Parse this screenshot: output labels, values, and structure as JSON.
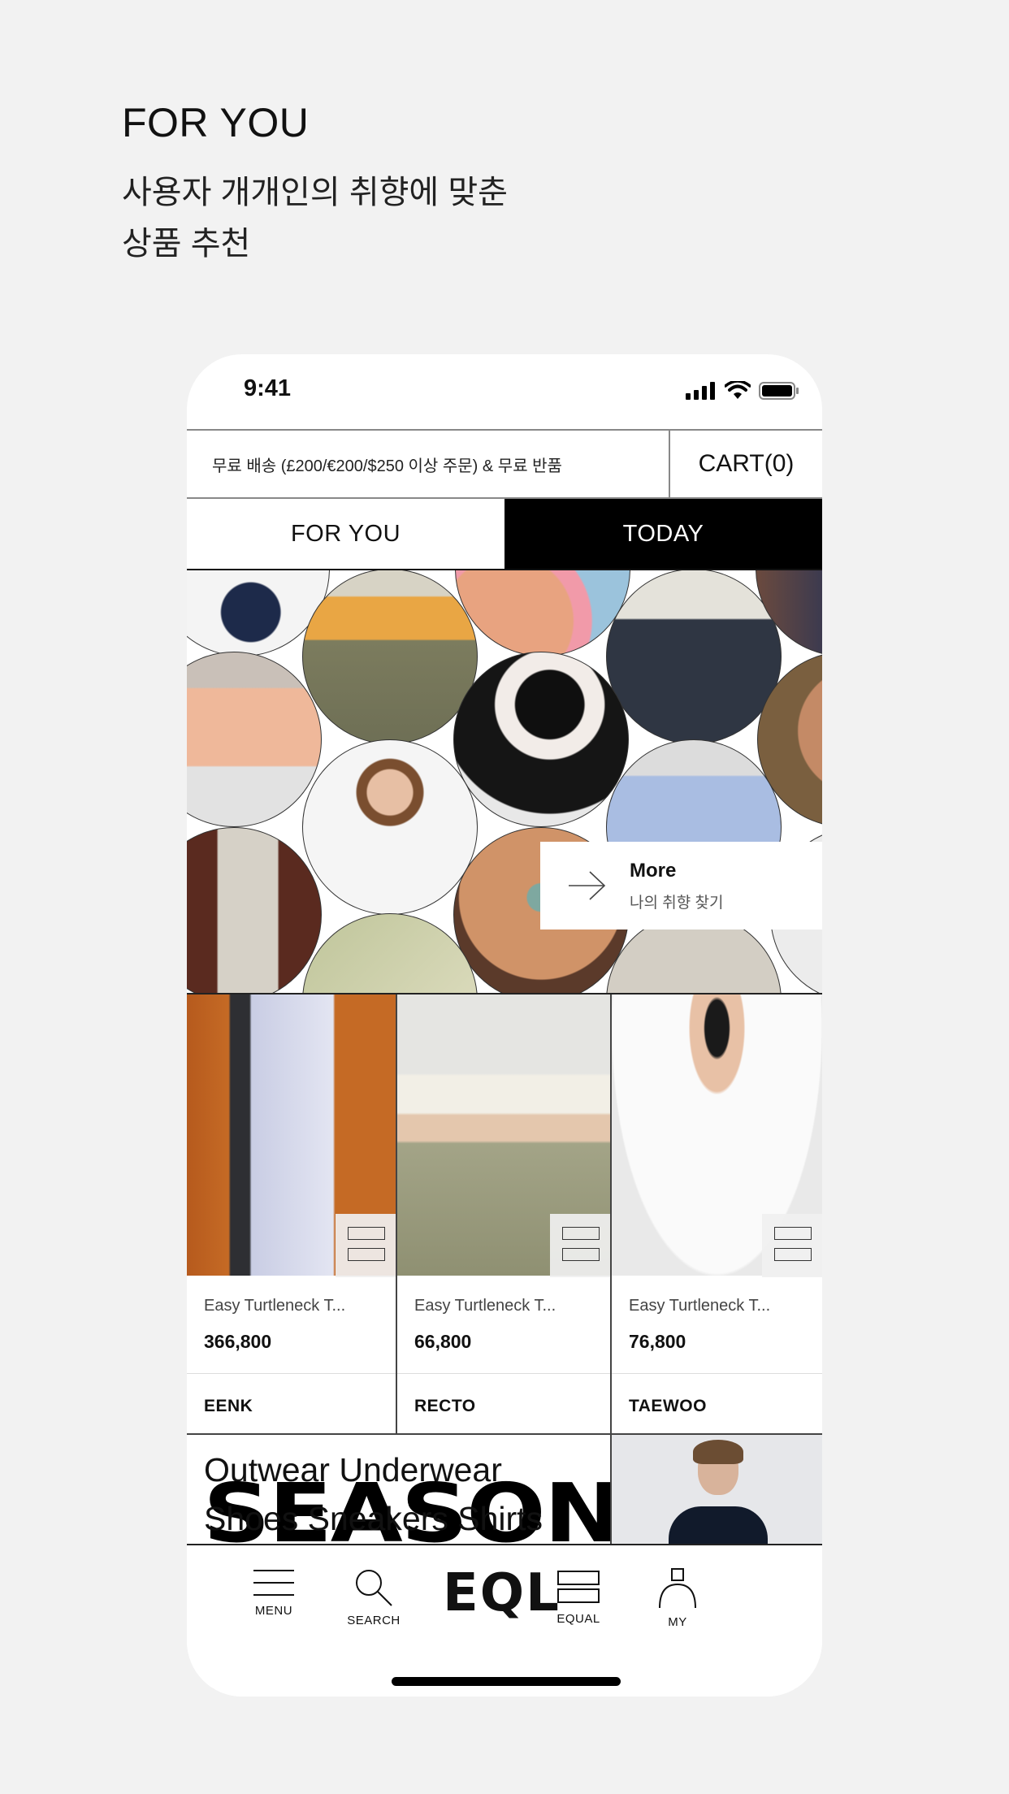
{
  "promo": {
    "headline": "FOR YOU",
    "sub_line1": "사용자 개개인의 취향에 맞춘",
    "sub_line2": "상품 추천"
  },
  "status_bar": {
    "time": "9:41"
  },
  "shipping_bar": {
    "text": "무료 배송 (£200/€200/$250 이상 주문) & 무료 반품",
    "cart_label": "CART(0)"
  },
  "tabs": [
    {
      "label": "FOR YOU",
      "active": false
    },
    {
      "label": "TODAY",
      "active": true
    }
  ],
  "more_card": {
    "title": "More",
    "subtitle": "나의 취향 찾기"
  },
  "products": [
    {
      "name": "Easy Turtleneck T...",
      "price": "366,800",
      "brand": "EENK"
    },
    {
      "name": "Easy Turtleneck T...",
      "price": "66,800",
      "brand": "RECTO"
    },
    {
      "name": "Easy Turtleneck T...",
      "price": "76,800",
      "brand": "TAEWOO"
    }
  ],
  "categories": {
    "line1": "Outwear Underwear",
    "line2": "Shoes Sneakers Shirts",
    "overlay": "SEASON"
  },
  "nav": {
    "menu": "MENU",
    "search": "SEARCH",
    "logo": "EQL",
    "equal": "EQUAL",
    "my": "MY"
  },
  "colors": {
    "accent": "#000000",
    "background": "#f2f2f2"
  }
}
